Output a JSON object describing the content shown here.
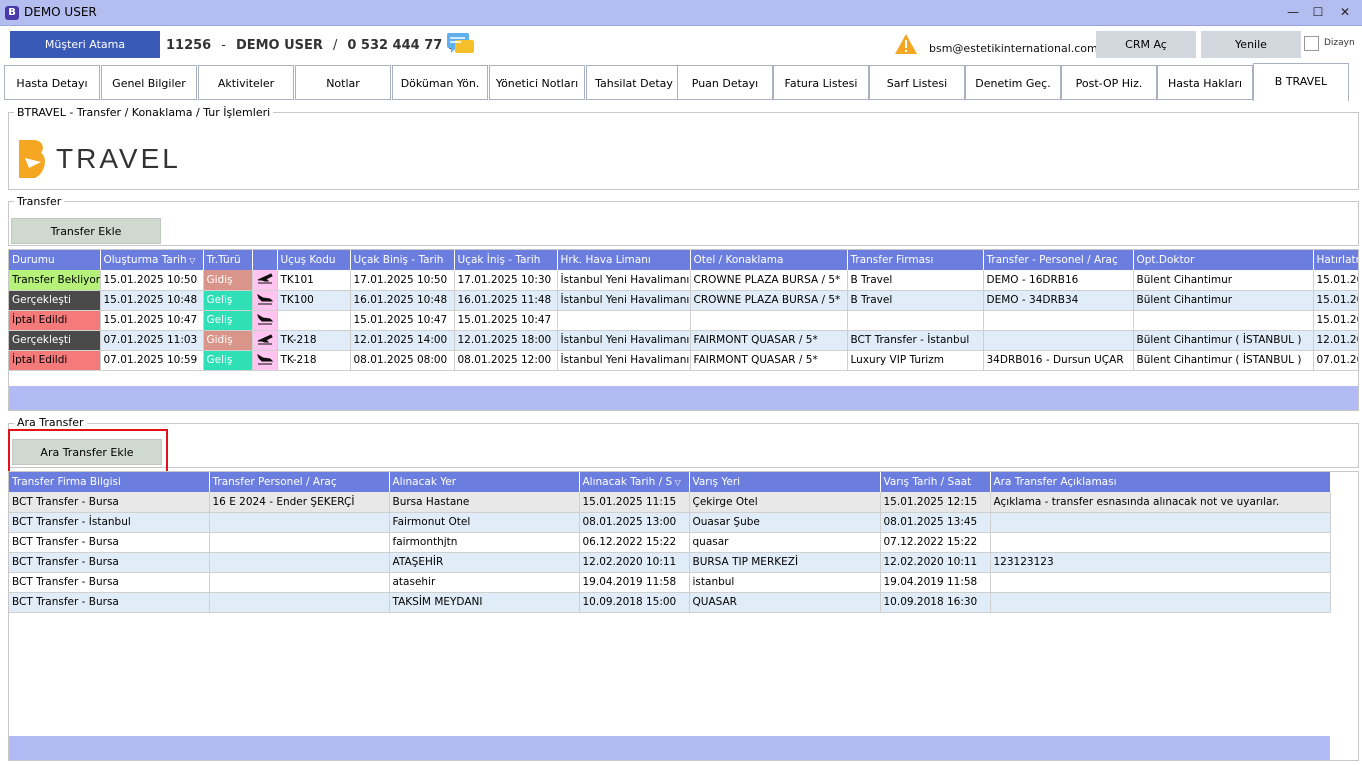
{
  "window": {
    "title": "DEMO USER",
    "app_letter": "B",
    "minimize": "—",
    "maximize": "☐",
    "close": "✕"
  },
  "header": {
    "assign_button": "Müşteri Atama",
    "patient_id": "11256",
    "sep1": "-",
    "patient_name": "DEMO USER",
    "sep2": "/",
    "phone": "0 532 444 77 07",
    "email": "bsm@estetikinternational.com",
    "crm_button": "CRM Aç",
    "refresh_button": "Yenile",
    "layout_checkbox_label": "Dizayn"
  },
  "tabs": [
    "Hasta Detayı",
    "Genel Bilgiler",
    "Aktiviteler",
    "Notlar",
    "Döküman Yön.",
    "Yönetici Notları",
    "Tahsilat Detay",
    "Puan Detayı",
    "Fatura Listesi",
    "Sarf Listesi",
    "Denetim Geç.",
    "Post-OP Hiz.",
    "Hasta Hakları",
    "B TRAVEL"
  ],
  "btravel": {
    "group_title": "BTRAVEL - Transfer / Konaklama / Tur İşlemleri",
    "logo_text": "TRAVEL"
  },
  "transfer": {
    "group_title": "Transfer",
    "add_button": "Transfer Ekle",
    "columns": [
      "Durumu",
      "Oluşturma Tarih",
      "Tr.Türü",
      "",
      "Uçuş Kodu",
      "Uçak Biniş - Tarih",
      "Uçak İniş - Tarih",
      "Hrk. Hava Limanı",
      "Otel / Konaklama",
      "Transfer Firması",
      "Transfer - Personel / Araç",
      "Opt.Doktor",
      "Hatırlatm"
    ],
    "rows": [
      {
        "status": "Transfer Bekliyor",
        "status_color": "#b6f27a",
        "created": "15.01.2025 10:50",
        "type": "Gidiş",
        "type_color": "#d9958a",
        "dir": "out",
        "flight": "TK101",
        "board": "17.01.2025 10:50",
        "land": "17.01.2025 10:30",
        "airport": "İstanbul Yeni Havalimanı",
        "hotel": "CROWNE PLAZA BURSA / 5*",
        "company": "B Travel",
        "staff": "DEMO - 16DRB16",
        "doctor": "Bülent Cihantimur",
        "reminder": "15.01.20"
      },
      {
        "status": "Gerçekleşti",
        "status_color": "#4a4a4a",
        "created": "15.01.2025 10:48",
        "type": "Geliş",
        "type_color": "#2fe0b6",
        "dir": "in",
        "flight": "TK100",
        "board": "16.01.2025 10:48",
        "land": "16.01.2025 11:48",
        "airport": "İstanbul Yeni Havalimanı",
        "hotel": "CROWNE PLAZA BURSA / 5*",
        "company": "B Travel",
        "staff": "DEMO - 34DRB34",
        "doctor": "Bülent Cihantimur",
        "reminder": "15.01.20"
      },
      {
        "status": "İptal Edildi",
        "status_color": "#f57b7b",
        "created": "15.01.2025 10:47",
        "type": "Geliş",
        "type_color": "#2fe0b6",
        "dir": "in",
        "flight": "",
        "board": "15.01.2025 10:47",
        "land": "15.01.2025 10:47",
        "airport": "",
        "hotel": "",
        "company": "",
        "staff": "",
        "doctor": "",
        "reminder": "15.01.20"
      },
      {
        "status": "Gerçekleşti",
        "status_color": "#4a4a4a",
        "created": "07.01.2025 11:03",
        "type": "Gidiş",
        "type_color": "#d9958a",
        "dir": "out",
        "flight": "TK-218",
        "board": "12.01.2025 14:00",
        "land": "12.01.2025 18:00",
        "airport": "İstanbul Yeni Havalimanı",
        "hotel": "FAIRMONT QUASAR / 5*",
        "company": "BCT Transfer - İstanbul",
        "staff": "",
        "doctor": "Bülent Cihantimur ( İSTANBUL )",
        "reminder": "12.01.20"
      },
      {
        "status": "İptal Edildi",
        "status_color": "#f57b7b",
        "created": "07.01.2025 10:59",
        "type": "Geliş",
        "type_color": "#2fe0b6",
        "dir": "in",
        "flight": "TK-218",
        "board": "08.01.2025 08:00",
        "land": "08.01.2025 12:00",
        "airport": "İstanbul Yeni Havalimanı",
        "hotel": "FAIRMONT QUASAR / 5*",
        "company": "Luxury VIP Turizm",
        "staff": "34DRB016 - Dursun UÇAR",
        "doctor": "Bülent Cihantimur ( İSTANBUL )",
        "reminder": "07.01.20"
      }
    ]
  },
  "inter_transfer": {
    "group_title": "Ara Transfer",
    "add_button": "Ara Transfer Ekle",
    "columns": [
      "Transfer Firma Bilgisi",
      "Transfer Personel / Araç",
      "Alınacak Yer",
      "Alınacak Tarih / S",
      "Varış Yeri",
      "Varış Tarih / Saat",
      "Ara Transfer Açıklaması"
    ],
    "rows": [
      {
        "company": "BCT Transfer - Bursa",
        "staff": "16 E 2024 - Ender ŞEKERÇİ",
        "pickup": "Bursa Hastane",
        "pickup_date": "15.01.2025 11:15",
        "dest": "Çekirge Otel",
        "dest_date": "15.01.2025 12:15",
        "note": "Açıklama - transfer esnasında alınacak not ve uyarılar."
      },
      {
        "company": "BCT Transfer - İstanbul",
        "staff": "",
        "pickup": "Fairmonut Otel",
        "pickup_date": "08.01.2025 13:00",
        "dest": "Ouasar Şube",
        "dest_date": "08.01.2025 13:45",
        "note": ""
      },
      {
        "company": "BCT Transfer - Bursa",
        "staff": "",
        "pickup": "fairmonthjtn",
        "pickup_date": "06.12.2022 15:22",
        "dest": "quasar",
        "dest_date": "07.12.2022 15:22",
        "note": ""
      },
      {
        "company": "BCT Transfer - Bursa",
        "staff": "",
        "pickup": "ATAŞEHİR",
        "pickup_date": "12.02.2020 10:11",
        "dest": "BURSA TIP MERKEZİ",
        "dest_date": "12.02.2020 10:11",
        "note": "123123123"
      },
      {
        "company": "BCT Transfer - Bursa",
        "staff": "",
        "pickup": "atasehir",
        "pickup_date": "19.04.2019 11:58",
        "dest": "istanbul",
        "dest_date": "19.04.2019 11:58",
        "note": ""
      },
      {
        "company": "BCT Transfer - Bursa",
        "staff": "",
        "pickup": "TAKSİM MEYDANI",
        "pickup_date": "10.09.2018 15:00",
        "dest": "QUASAR",
        "dest_date": "10.09.2018 16:30",
        "note": ""
      }
    ]
  },
  "colors": {
    "accent": "#6b7ee0",
    "brand_orange": "#f5a623",
    "highlight_red": "#e0131a"
  }
}
